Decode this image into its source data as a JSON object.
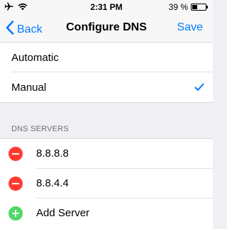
{
  "status_bar": {
    "time": "2:31 PM",
    "battery_text": "39 %",
    "battery_level": 0.39
  },
  "nav": {
    "back_label": "Back",
    "title": "Configure DNS",
    "save_label": "Save"
  },
  "mode": {
    "options": [
      {
        "label": "Automatic",
        "selected": false
      },
      {
        "label": "Manual",
        "selected": true
      }
    ]
  },
  "dns": {
    "section_header": "DNS SERVERS",
    "servers": [
      "8.8.8.8",
      "8.8.4.4"
    ],
    "add_label": "Add Server"
  },
  "colors": {
    "accent": "#007aff",
    "remove": "#ff3b30",
    "add": "#4cd964"
  },
  "icons": {
    "back": "chevron-left-icon",
    "check": "checkmark-icon",
    "remove": "minus-circle-icon",
    "add": "plus-circle-icon"
  }
}
